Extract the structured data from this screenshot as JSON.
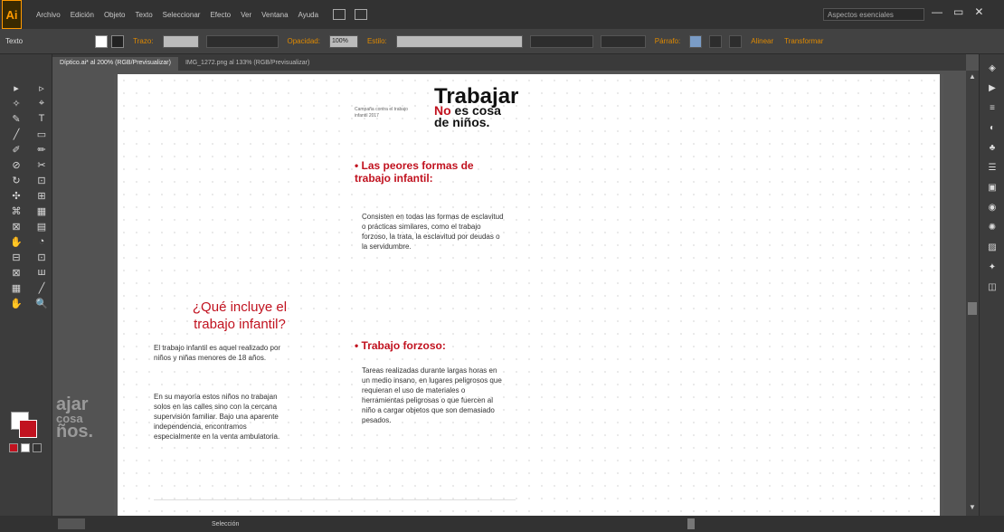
{
  "app": {
    "logo": "Ai",
    "menu": [
      "Archivo",
      "Edición",
      "Objeto",
      "Texto",
      "Seleccionar",
      "Efecto",
      "Ver",
      "Ventana",
      "Ayuda"
    ],
    "workspace": "Aspectos esenciales",
    "window_controls": [
      "—",
      "▭",
      "✕"
    ]
  },
  "control_bar": {
    "label": "Texto",
    "stroke_label": "Trazo:",
    "opacity_label": "Opacidad:",
    "opacity_value": "100%",
    "style_label": "Estilo:",
    "char_label": "Párrafo:",
    "align_label": "Alinear",
    "transform_label": "Transformar"
  },
  "tabs": [
    {
      "label": "Díptico.ai* al 200% (RGB/Previsualizar)",
      "active": true
    },
    {
      "label": "IMG_1272.png al 133% (RGB/Previsualizar)",
      "active": false
    }
  ],
  "tools": [
    "▸",
    "▹",
    "✧",
    "⌖",
    "✎",
    "T",
    "╱",
    "▭",
    "✐",
    "✏",
    "⊘",
    "✂",
    "↻",
    "⊡",
    "✣",
    "⊞",
    "⌘",
    "▦",
    "⊠",
    "▤",
    "✋",
    "◔",
    "⊟",
    "⊡",
    "⊠",
    "ш",
    "▦",
    "╱",
    "✋",
    "🔍"
  ],
  "sidetext": [
    "ajar",
    "cosa",
    "ños."
  ],
  "doc": {
    "campaign": "Campaña contra el trabajo infantil 2017",
    "brand_title": "Trabajar",
    "brand_no": "No",
    "brand_rest": " es cosa",
    "brand_line3": "de niños.",
    "section1_title": "• Las peores formas de trabajo infantil:",
    "section1_body": "Consisten en todas las formas de esclavitud o prácticas similares, como el trabajo forzoso, la trata, la esclavitud por deudas o la servidumbre.",
    "section2_title": "¿Qué incluye el trabajo infantil?",
    "section2_body1": "El trabajo infantil es aquel realizado por niños y niñas menores de 18 años.",
    "section2_body2": "En su mayoría estos niños no trabajan solos en las calles sino con la cercana supervisión familiar. Bajo una aparente independencia, encontramos especialmente en la venta ambulatoria.",
    "section3_title": "• Trabajo forzoso:",
    "section3_body": "Tareas realizadas durante largas horas en un medio insano, en lugares peligrosos que requieran el uso de materiales o herramientas peligrosas o que fuercen al niño a cargar objetos que son demasiado pesados."
  },
  "status": {
    "tool_name": "Selección"
  },
  "right_icons": [
    "◈",
    "▶",
    "≡",
    "◐",
    "♣",
    "☰",
    "▣",
    "◉",
    "✺",
    "▨",
    "✦",
    "◫"
  ],
  "colors": {
    "accent_red": "#c1121f",
    "ai_orange": "#ff9a00"
  }
}
